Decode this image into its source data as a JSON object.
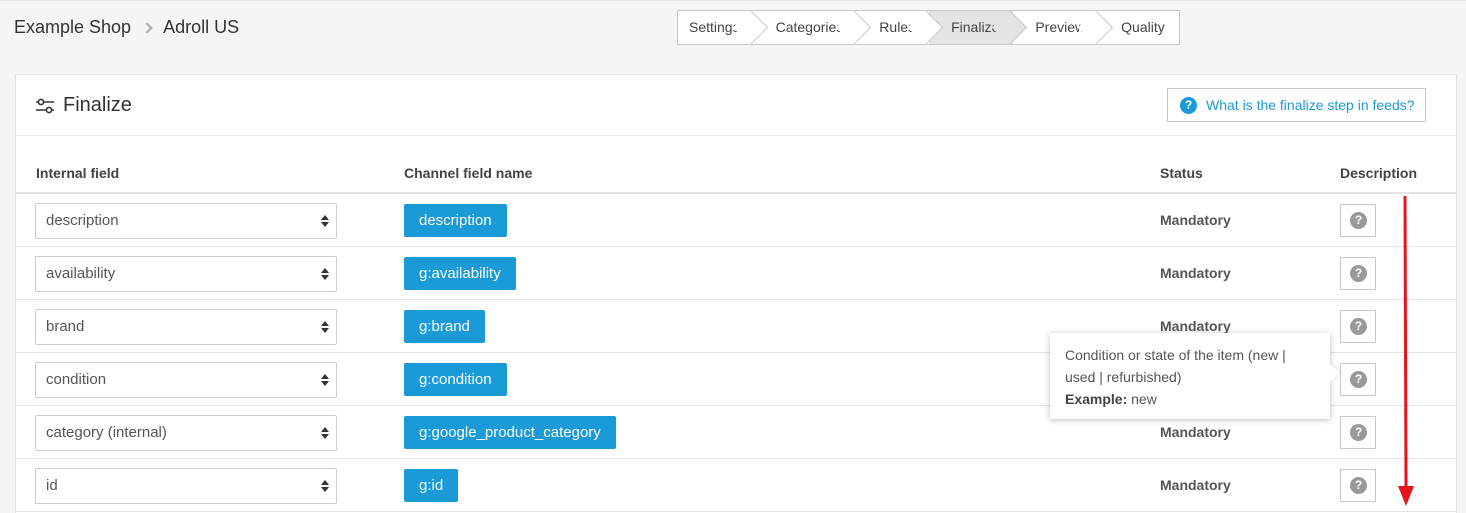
{
  "breadcrumb": {
    "shop": "Example Shop",
    "channel": "Adroll US"
  },
  "steps": [
    "Settings",
    "Categories",
    "Rules",
    "Finalize",
    "Preview",
    "Quality"
  ],
  "active_step": "Finalize",
  "card": {
    "title": "Finalize",
    "help_label": "What is the finalize step in feeds?"
  },
  "table": {
    "headers": {
      "internal": "Internal field",
      "channel": "Channel field name",
      "status": "Status",
      "description": "Description"
    },
    "rows": [
      {
        "internal": "description",
        "channel": "description",
        "status": "Mandatory"
      },
      {
        "internal": "availability",
        "channel": "g:availability",
        "status": "Mandatory"
      },
      {
        "internal": "brand",
        "channel": "g:brand",
        "status": "Mandatory"
      },
      {
        "internal": "condition",
        "channel": "g:condition",
        "status": ""
      },
      {
        "internal": "category (internal)",
        "channel": "g:google_product_category",
        "status": "Mandatory"
      },
      {
        "internal": "id",
        "channel": "g:id",
        "status": "Mandatory"
      }
    ]
  },
  "tooltip": {
    "text": "Condition or state of the item (new | used | refurbished)",
    "example_label": "Example:",
    "example_value": "new"
  },
  "colors": {
    "accent": "#1a9ad6",
    "annotation": "#e8141c"
  },
  "icons": {
    "help": "question-circle-icon",
    "finalize": "sliders-icon",
    "crumb_sep": "chevron-right-icon",
    "select": "sort-arrows-icon",
    "annotation": "arrow-down-icon"
  }
}
